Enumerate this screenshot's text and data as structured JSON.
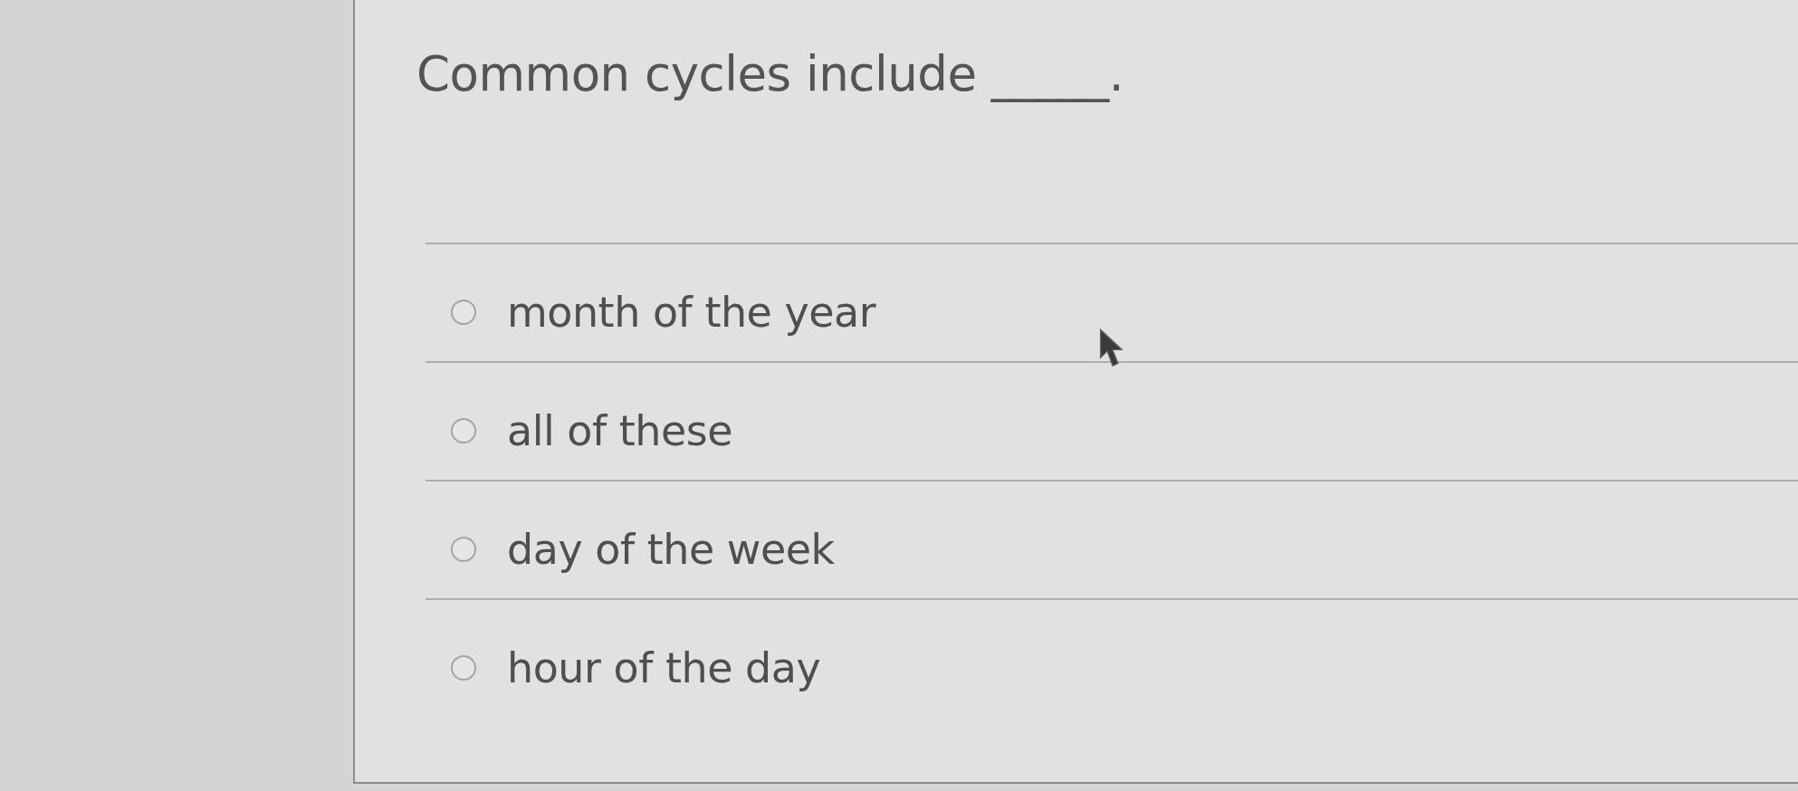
{
  "question": {
    "text": "Common cycles include _____."
  },
  "options": [
    {
      "label": "month of the year",
      "selected": false
    },
    {
      "label": "all of these",
      "selected": false
    },
    {
      "label": "day of the week",
      "selected": false
    },
    {
      "label": "hour of the day",
      "selected": false
    }
  ]
}
